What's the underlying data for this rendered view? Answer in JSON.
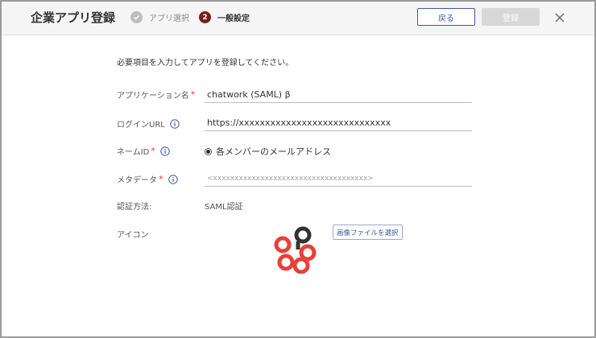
{
  "header": {
    "title": "企業アプリ登録",
    "step1_label": "アプリ選択",
    "step2_number": "2",
    "step2_label": "一般設定",
    "back_label": "戻る",
    "register_label": "登録",
    "close_icon": "close-icon"
  },
  "form": {
    "instruction": "必要項目を入力してアプリを登録してください。",
    "app_name_label": "アプリケーション名",
    "app_name_value": "chatwork (SAML) β",
    "login_url_label": "ログインURL",
    "login_url_value": "https://xxxxxxxxxxxxxxxxxxxxxxxxxxxxx",
    "name_id_label": "ネームID",
    "name_id_option": "各メンバーのメールアドレス",
    "metadata_label": "メタデータ",
    "metadata_placeholder": "<xxxxxxxxxxxxxxxxxxxxxxxxxxxxxxxxxxxx>",
    "auth_method_label": "認証方法:",
    "auth_method_value": "SAML認証",
    "icon_label": "アイコン",
    "select_image_label": "画像ファイルを選択",
    "required_mark": "*"
  },
  "colors": {
    "accent": "#3a57a8",
    "required": "#e53935",
    "step_active": "#7b1c1c",
    "logo_red": "#e8403a",
    "logo_dark": "#333333"
  }
}
